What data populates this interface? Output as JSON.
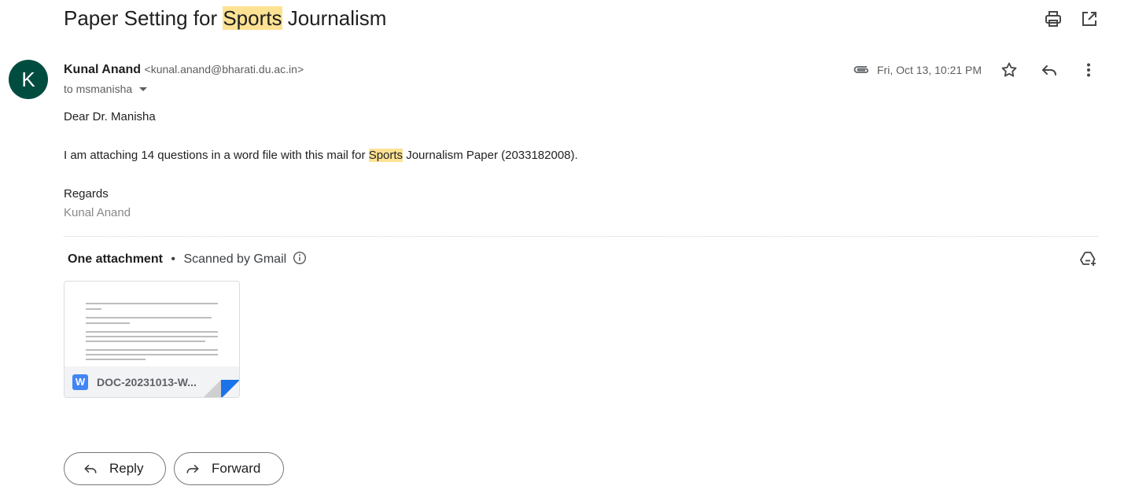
{
  "subject": {
    "before": "Paper Setting for ",
    "highlight": "Sports",
    "after": " Journalism"
  },
  "sender": {
    "initial": "K",
    "name": "Kunal Anand",
    "email": "<kunal.anand@bharati.du.ac.in>",
    "recipients": "to msmanisha"
  },
  "date": "Fri, Oct 13, 10:21 PM",
  "body": {
    "greeting": "Dear Dr. Manisha",
    "line_before": "I am attaching 14 questions in a word file with this mail for ",
    "line_highlight": "Sports",
    "line_after": " Journalism Paper (2033182008).",
    "closing": "Regards",
    "signature": "Kunal Anand"
  },
  "attachments": {
    "count_label": "One attachment",
    "separator": "•",
    "scan_label": "Scanned by Gmail",
    "file": {
      "badge": "W",
      "name": "DOC-20231013-W..."
    }
  },
  "actions": {
    "reply": "Reply",
    "forward": "Forward"
  },
  "colors": {
    "highlight": "#fde293",
    "avatar": "#004d40",
    "word_blue": "#4285f4"
  },
  "icons": [
    "print-icon",
    "open-in-new-icon",
    "paperclip-icon",
    "star-icon",
    "reply-icon",
    "more-vert-icon",
    "info-icon",
    "add-to-drive-icon",
    "word-icon",
    "forward-icon"
  ]
}
